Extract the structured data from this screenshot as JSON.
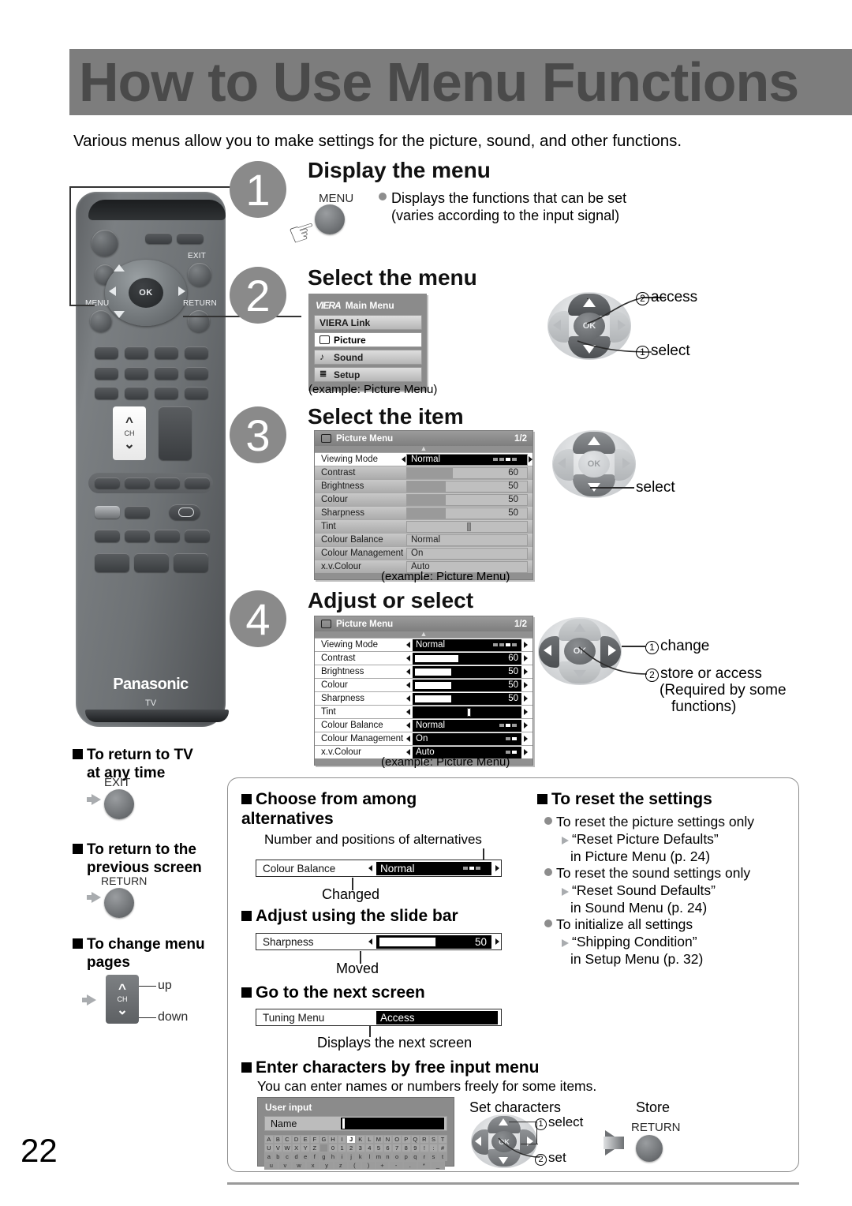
{
  "page": {
    "title": "How to Use Menu Functions",
    "intro": "Various menus allow you to make settings for the picture, sound, and other functions.",
    "number": "22"
  },
  "remote": {
    "brand": "Panasonic",
    "sub_brand": "TV",
    "labels": {
      "exit": "EXIT",
      "menu": "MENU",
      "return": "RETURN",
      "ok": "OK",
      "ch": "CH"
    }
  },
  "steps": [
    {
      "number": "1",
      "heading": "Display the menu",
      "key_label": "MENU",
      "bullet": "Displays the functions that can be set",
      "bullet_sub": "(varies according to the input signal)"
    },
    {
      "number": "2",
      "heading": "Select the menu",
      "caption": "(example: Picture Menu)",
      "annotations": [
        {
          "num": "2",
          "text": "access"
        },
        {
          "num": "1",
          "text": "select"
        }
      ]
    },
    {
      "number": "3",
      "heading": "Select the item",
      "caption": "(example: Picture Menu)",
      "annotations": [
        {
          "num": "",
          "text": "select"
        }
      ]
    },
    {
      "number": "4",
      "heading": "Adjust or select",
      "caption": "(example: Picture Menu)",
      "annotations": [
        {
          "num": "1",
          "text": "change"
        },
        {
          "num": "2",
          "text": "store or access"
        }
      ],
      "annotation_note_1": "(Required by some",
      "annotation_note_2": "functions)"
    }
  ],
  "main_menu": {
    "logo": "VIERA",
    "title": "Main Menu",
    "items": [
      {
        "label": "VIERA Link",
        "icon": "",
        "selected": false
      },
      {
        "label": "Picture",
        "icon": "screen-icon",
        "selected": true
      },
      {
        "label": "Sound",
        "icon": "note-icon",
        "selected": false
      },
      {
        "label": "Setup",
        "icon": "list-icon",
        "selected": false
      }
    ]
  },
  "picture_menu": {
    "title": "Picture Menu",
    "page": "1/2",
    "rows": [
      {
        "name": "Viewing Mode",
        "value": "Normal",
        "type": "alternatives",
        "alts": 4,
        "alt_index": 2
      },
      {
        "name": "Contrast",
        "value": "60",
        "type": "slider",
        "percent": 60
      },
      {
        "name": "Brightness",
        "value": "50",
        "type": "slider",
        "percent": 50
      },
      {
        "name": "Colour",
        "value": "50",
        "type": "slider",
        "percent": 50
      },
      {
        "name": "Sharpness",
        "value": "50",
        "type": "slider",
        "percent": 50
      },
      {
        "name": "Tint",
        "value": "",
        "type": "centered"
      },
      {
        "name": "Colour Balance",
        "value": "Normal",
        "type": "alternatives",
        "alts": 3,
        "alt_index": 1
      },
      {
        "name": "Colour Management",
        "value": "On",
        "type": "alternatives",
        "alts": 2,
        "alt_index": 1
      },
      {
        "name": "x.v.Colour",
        "value": "Auto",
        "type": "alternatives",
        "alts": 2,
        "alt_index": 1
      }
    ]
  },
  "side_notes": [
    {
      "heading_line1": "To return to TV",
      "heading_line2": "at any time",
      "key": "EXIT"
    },
    {
      "heading_line1": "To return to the",
      "heading_line2": "previous screen",
      "key": "RETURN"
    },
    {
      "heading_line1": "To change menu",
      "heading_line2": "pages",
      "key": "CH",
      "up": "up",
      "down": "down"
    }
  ],
  "boxed": {
    "choose": {
      "heading_line1": "Choose from among",
      "heading_line2": "alternatives",
      "note_top": "Number and positions of alternatives",
      "note_bottom": "Changed",
      "bar": {
        "name": "Colour Balance",
        "value": "Normal",
        "alts": 3,
        "alt_index": 1
      }
    },
    "slide": {
      "heading": "Adjust using the slide bar",
      "note_bottom": "Moved",
      "bar": {
        "name": "Sharpness",
        "value": "50",
        "percent": 50
      }
    },
    "next_screen": {
      "heading": "Go to the next screen",
      "note_bottom": "Displays the next screen",
      "bar": {
        "name": "Tuning Menu",
        "value": "Access"
      }
    },
    "free_input": {
      "heading": "Enter characters by free input menu",
      "subtext": "You can enter names or numbers freely for some items.",
      "set_characters_label": "Set characters",
      "store_label": "Store",
      "store_key": "RETURN",
      "annotations": [
        {
          "num": "1",
          "text": "select"
        },
        {
          "num": "2",
          "text": "set"
        }
      ],
      "panel": {
        "title": "User input",
        "field_label": "Name",
        "field_value": "",
        "selected_key": "J",
        "keyboard": [
          [
            "A",
            "B",
            "C",
            "D",
            "E",
            "F",
            "G",
            "H",
            "I",
            "J",
            "K",
            "L",
            "M",
            "N",
            "O",
            "P",
            "Q",
            "R",
            "S",
            "T"
          ],
          [
            "U",
            "V",
            "W",
            "X",
            "Y",
            "Z",
            "",
            "0",
            "1",
            "2",
            "3",
            "4",
            "5",
            "6",
            "7",
            "8",
            "9",
            "!",
            ":",
            "#"
          ],
          [
            "a",
            "b",
            "c",
            "d",
            "e",
            "f",
            "g",
            "h",
            "i",
            "j",
            "k",
            "l",
            "m",
            "n",
            "o",
            "p",
            "q",
            "r",
            "s",
            "t"
          ],
          [
            "u",
            "v",
            "w",
            "x",
            "y",
            "z",
            "(",
            ")",
            "+",
            "-",
            ".",
            "*",
            "_"
          ]
        ]
      }
    },
    "reset": {
      "heading": "To reset the settings",
      "items": [
        {
          "bullet": "To reset the picture settings only",
          "quote": "“Reset Picture Defaults”",
          "where": "in Picture Menu (p. 24)"
        },
        {
          "bullet": "To reset the sound settings only",
          "quote": "“Reset Sound Defaults”",
          "where": "in Sound Menu (p. 24)"
        },
        {
          "bullet": "To initialize all settings",
          "quote": "“Shipping Condition”",
          "where": "in Setup Menu (p. 32)"
        }
      ]
    }
  },
  "colors": {
    "header_band": "#7d7d7d",
    "title_gray": "#4a4a4a",
    "step_circle": "#8a8a8a",
    "osd_gray": "#8b8b8b"
  }
}
